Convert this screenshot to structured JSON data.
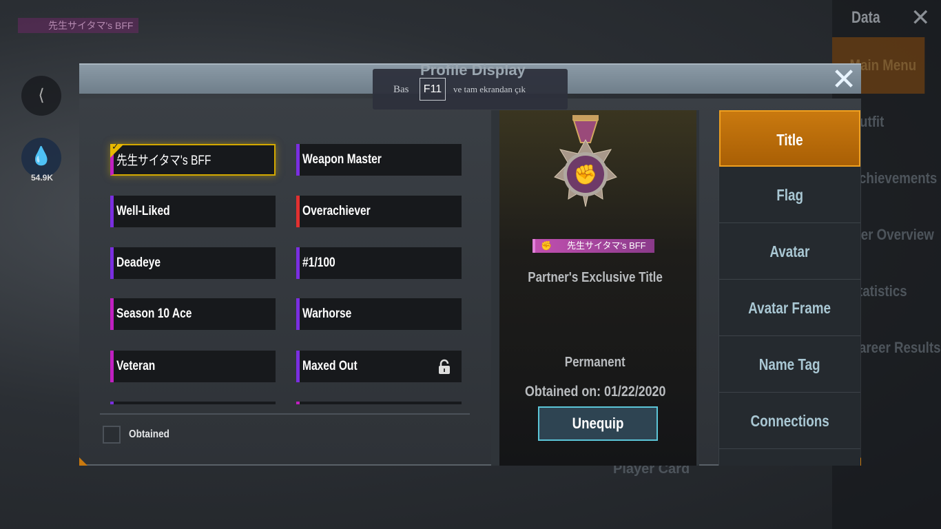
{
  "background": {
    "player_title": "先生サイタマ's BFF",
    "share_icon": "share-icon",
    "currency_value": "54.9K",
    "menu_header": "Data",
    "menu_items": [
      "Main Menu",
      "Outfit",
      "Achievements",
      "Tier Overview",
      "Statistics",
      "Career Results"
    ],
    "player_card": "Player Card"
  },
  "toast": {
    "prefix": "Bas",
    "key": "F11",
    "suffix": "ve tam ekrandan çık"
  },
  "modal": {
    "title": "Profile Display",
    "close_icon": "close-icon",
    "titles": [
      {
        "label": "先生サイタマ's BFF",
        "accent": "#c020c0",
        "selected": true,
        "equipped": true
      },
      {
        "label": "Weapon Master",
        "accent": "#7a2ee0"
      },
      {
        "label": "Well-Liked",
        "accent": "#7a2ee0"
      },
      {
        "label": "Overachiever",
        "accent": "#e03030"
      },
      {
        "label": "Deadeye",
        "accent": "#7a2ee0"
      },
      {
        "label": "#1/100",
        "accent": "#7a2ee0"
      },
      {
        "label": "Season 10 Ace",
        "accent": "#c020c0"
      },
      {
        "label": "Warhorse",
        "accent": "#7a2ee0"
      },
      {
        "label": "Veteran",
        "accent": "#c020c0"
      },
      {
        "label": "Maxed Out",
        "accent": "#7a2ee0",
        "locked": true
      }
    ],
    "filter": {
      "label": "Obtained",
      "checked": false
    },
    "detail": {
      "badge_text": "先生サイタマ's BFF",
      "name": "Partner's Exclusive Title",
      "duration": "Permanent",
      "obtained": "Obtained on: 01/22/2020",
      "button": "Unequip"
    },
    "tabs": [
      {
        "label": "Title",
        "active": true
      },
      {
        "label": "Flag"
      },
      {
        "label": "Avatar"
      },
      {
        "label": "Avatar Frame"
      },
      {
        "label": "Name Tag"
      },
      {
        "label": "Connections"
      }
    ],
    "colors": {
      "accent": "#c9790f",
      "selection": "#d4a900",
      "button_border": "#5cc6d8"
    }
  }
}
